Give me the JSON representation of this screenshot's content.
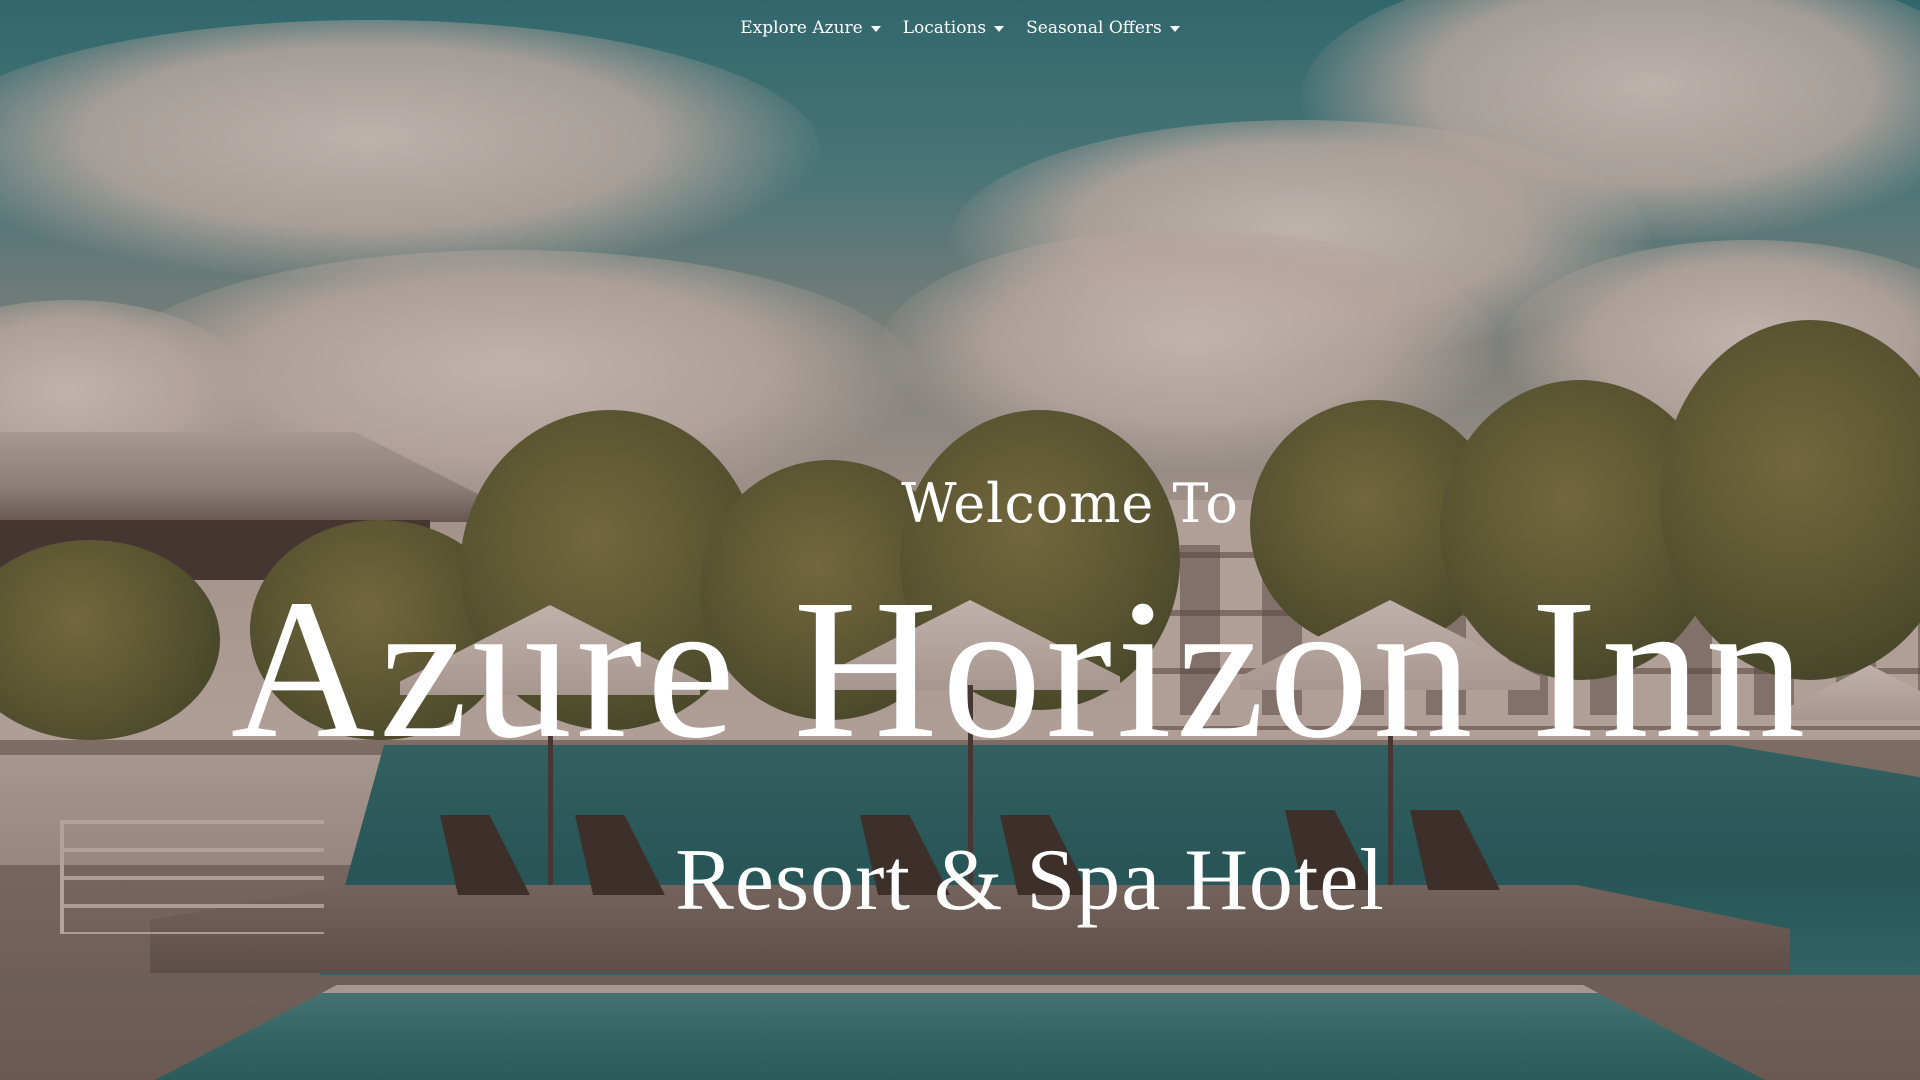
{
  "nav": {
    "items": [
      {
        "label": "Explore Azure",
        "icon": "caret-down-icon"
      },
      {
        "label": "Locations",
        "icon": "caret-down-icon"
      },
      {
        "label": "Seasonal Offers",
        "icon": "caret-down-icon"
      }
    ]
  },
  "hero": {
    "welcome": "Welcome To",
    "title": "Azure Horizon Inn",
    "subtitle": "Resort & Spa Hotel"
  },
  "colors": {
    "text": "#ffffff",
    "overlay": "#5c423c",
    "pool": "#1f6f72",
    "sky": "#1c7a84"
  }
}
